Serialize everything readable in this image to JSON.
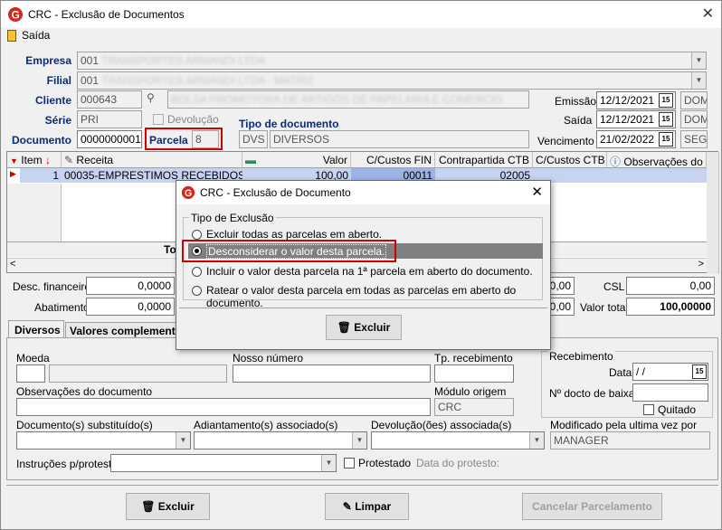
{
  "window": {
    "title": "CRC - Exclusão de Documentos",
    "close_glyph": "✕"
  },
  "menu": {
    "exit_label": "Saída"
  },
  "header": {
    "empresa_label": "Empresa",
    "empresa_value": "001",
    "empresa_name": "TRANSPORTES ARMANDI LTDA",
    "filial_label": "Filial",
    "filial_value": "001",
    "filial_name": "TRANSPORTES ARMANDI LTDA - MATRIZ",
    "cliente_label": "Cliente",
    "cliente_value": "000643",
    "cliente_name": "BOLSA PROMOTORA DE ARTIGOS DE PAPELARIA E COMERCIO",
    "serie_label": "Série",
    "serie_value": "PRI",
    "devolucao_label": "Devolução",
    "tipo_doc_label": "Tipo de documento",
    "tipo_doc_code": "DVS",
    "tipo_doc_name": "DIVERSOS",
    "documento_label": "Documento",
    "documento_value": "0000000001",
    "parcela_label": "Parcela",
    "parcela_value": "8",
    "emissao_label": "Emissão",
    "emissao_value": "12/12/2021",
    "emissao_day": "DOM",
    "saida_label": "Saída",
    "saida_value": "12/12/2021",
    "saida_day": "DOM",
    "vencimento_label": "Vencimento",
    "vencimento_value": "21/02/2022",
    "vencimento_day": "SEG",
    "cal_icon_text": "15"
  },
  "grid": {
    "columns": [
      "Item",
      "Receita",
      "Valor",
      "C/Custos FIN",
      "Contrapartida CTB",
      "C/Custos CTB",
      "Observações do ite"
    ],
    "rows": [
      {
        "item": "1",
        "receita": "00035-EMPRESTIMOS RECEBIDOS",
        "valor": "100,00",
        "ccfin": "00011",
        "contrapartida": "02005",
        "ccctb": "",
        "obs": ""
      }
    ],
    "total_label": "To"
  },
  "totals": {
    "desc_fin_label": "Desc. financeiro",
    "desc_fin_value": "0,0000",
    "abatimento_label": "Abatimento",
    "abatimento_value": "0,0000",
    "mid_value_1": "0,00",
    "mid_value_2": "0,00",
    "csl_label": "CSL",
    "csl_value": "0,00",
    "valor_total_label": "Valor total",
    "valor_total_value": "100,00000"
  },
  "tabs": {
    "tab1": "Diversos",
    "tab2": "Valores complementa"
  },
  "diversos": {
    "moeda_label": "Moeda",
    "nosso_numero_label": "Nosso número",
    "tp_recebimento_label": "Tp. recebimento",
    "obs_doc_label": "Observações do documento",
    "modulo_origem_label": "Módulo origem",
    "modulo_origem_value": "CRC",
    "doc_subst_label": "Documento(s) substituído(s)",
    "adiant_label": "Adiantamento(s) associado(s)",
    "devol_label": "Devolução(ões) associada(s)",
    "modificado_label": "Modificado pela ultima vez por",
    "modificado_value": "MANAGER",
    "instrucoes_label": "Instruções p/protesto",
    "protestado_label": "Protestado",
    "data_protesto_label": "Data do protesto:",
    "recebimento_group": "Recebimento",
    "data_label": "Data",
    "data_value": " /  /",
    "n_docto_baixa_label": "Nº docto de baixa",
    "quitado_label": "Quitado"
  },
  "footer": {
    "excluir_label": "Excluir",
    "limpar_label": "Limpar",
    "cancelar_label": "Cancelar Parcelamento"
  },
  "dialog": {
    "title": "CRC - Exclusão de Documento",
    "group_label": "Tipo de Exclusão",
    "options": [
      "Excluir todas as parcelas em aberto.",
      "Desconsiderar o valor desta  parcela.",
      "Incluir o valor desta parcela na 1ª parcela em aberto do documento.",
      "Ratear o valor desta parcela em todas as parcelas em aberto do documento."
    ],
    "selected_index": 1,
    "excluir_label": "Excluir"
  },
  "colors": {
    "label_blue": "#0b2a7a",
    "highlight_red": "#d40000",
    "selected_row": "#808080"
  }
}
